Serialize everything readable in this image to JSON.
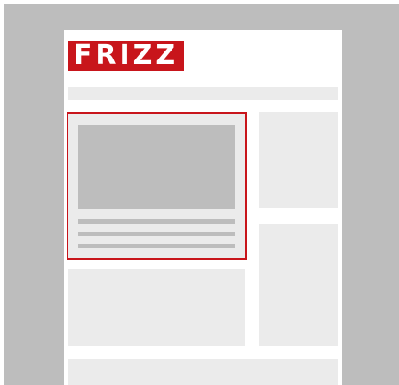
{
  "header": {
    "logo_text": "FRIZZ"
  },
  "colors": {
    "brand_red": "#c8151b",
    "frame_gray": "#bdbdbd",
    "placeholder_gray": "#ebebeb",
    "page_white": "#ffffff"
  }
}
